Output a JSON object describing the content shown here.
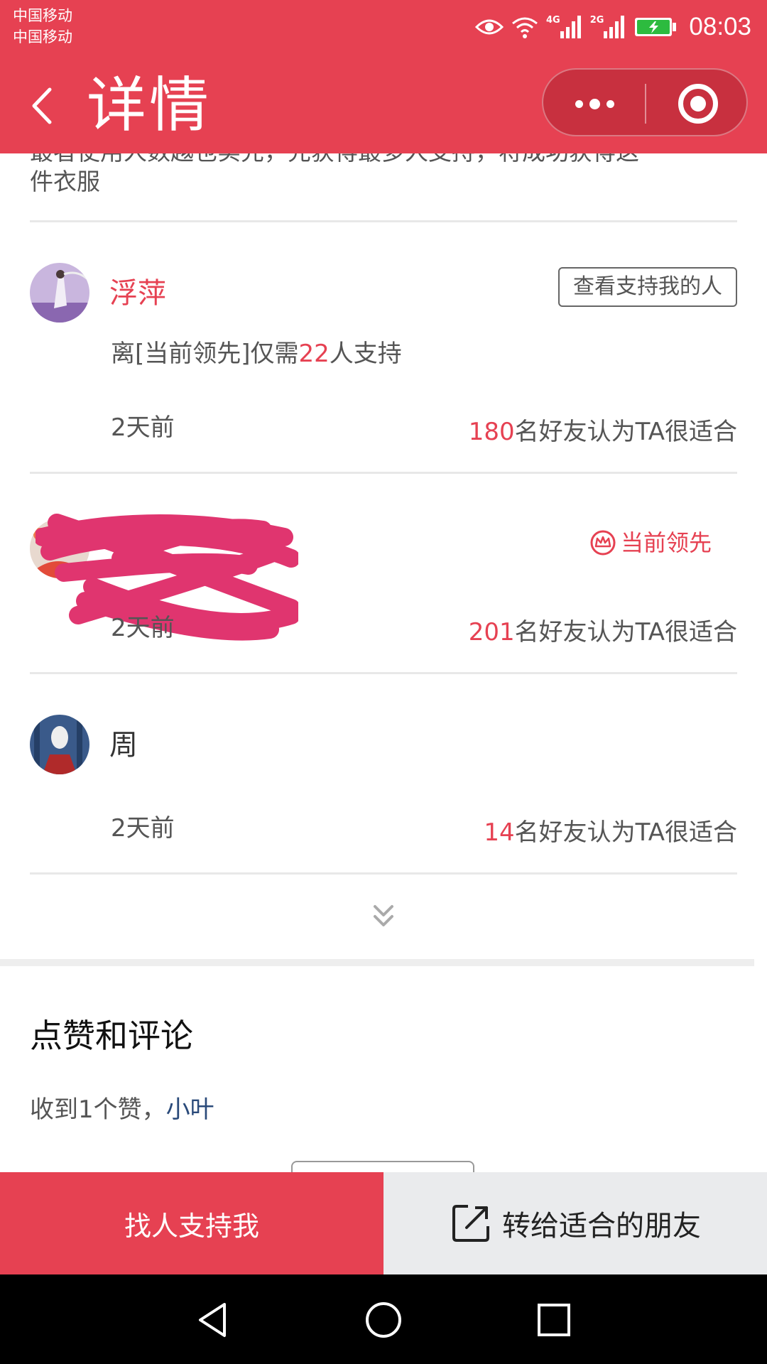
{
  "status_bar": {
    "carrier_1": "中国移动",
    "carrier_2": "中国移动",
    "net_1": "4G",
    "net_2": "2G",
    "time": "08:03",
    "battery_color": "#2dbb3f"
  },
  "nav": {
    "title": "详情",
    "accent": "#e64152"
  },
  "description": {
    "cut_line": "最者使用人数越也实先，先获得最多人支持，将成功获得这",
    "last_line": "件衣服"
  },
  "entries": [
    {
      "name": "浮萍",
      "see_supporters_label": "查看支持我的人",
      "gap_prefix": "离[当前领先]仅需",
      "gap_number": "22",
      "gap_suffix": "人支持",
      "time": "2天前",
      "votes": "180",
      "votes_suffix": "名好友认为TA很适合"
    },
    {
      "badge": "当前领先",
      "time": "2天前",
      "votes": "201",
      "votes_suffix": "名好友认为TA很适合"
    },
    {
      "name": "周",
      "time": "2天前",
      "votes": "14",
      "votes_suffix": "名好友认为TA很适合"
    }
  ],
  "comments": {
    "title": "点赞和评论",
    "likes_prefix": "收到1个赞，",
    "liked_by": "小叶"
  },
  "actions": {
    "primary": "找人支持我",
    "secondary": "转给适合的朋友"
  }
}
